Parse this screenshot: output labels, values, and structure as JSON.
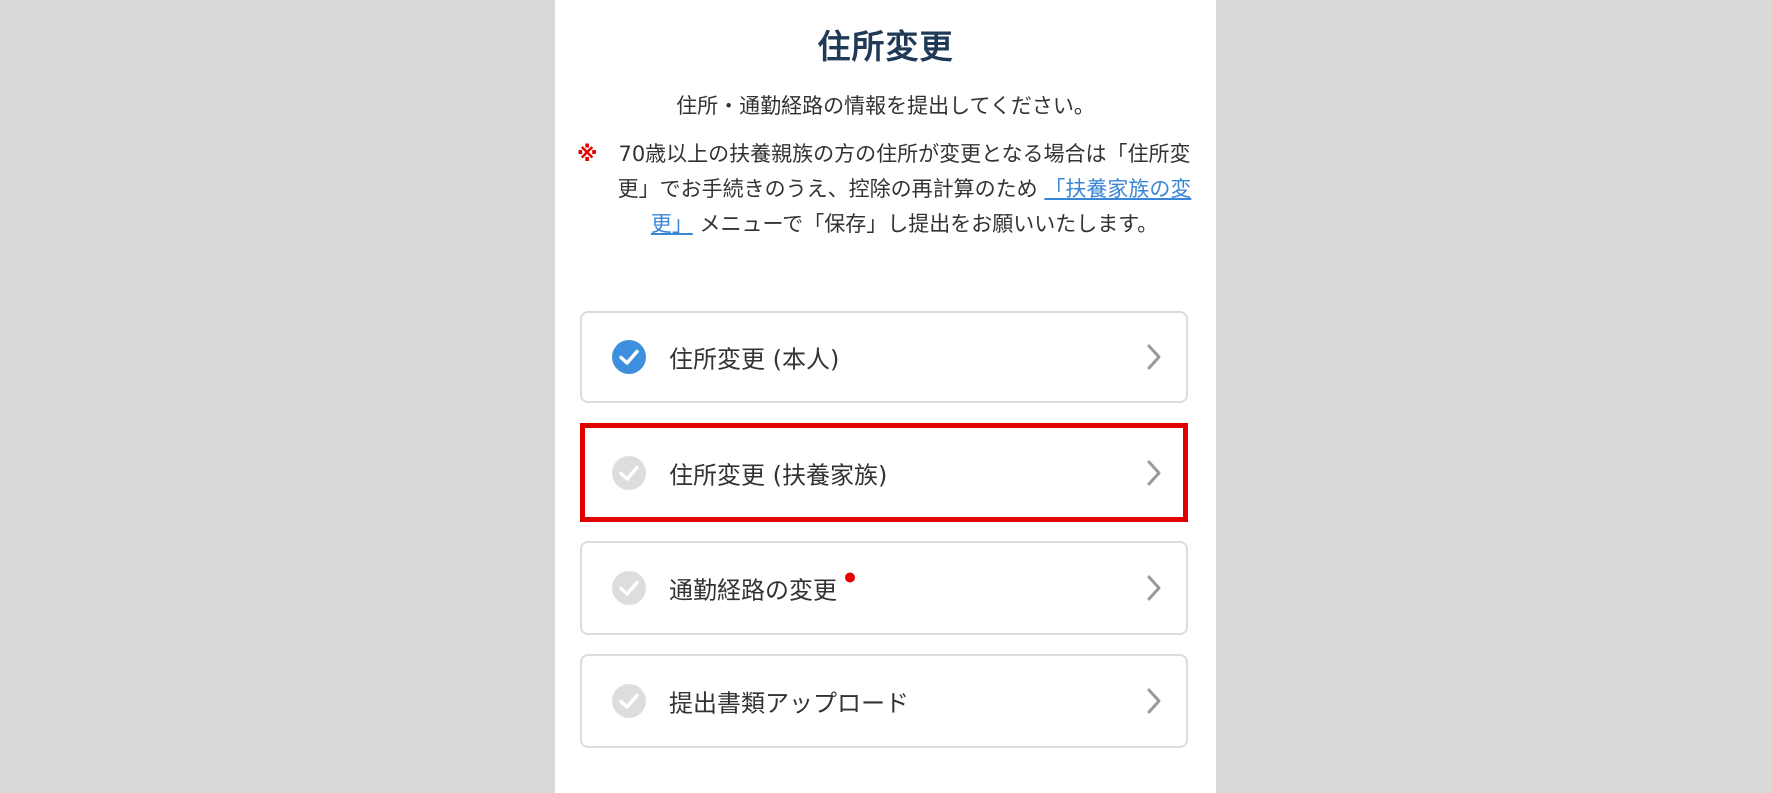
{
  "page": {
    "title": "住所変更",
    "subtitle": "住所・通勤経路の情報を提出してください。",
    "notice": {
      "mark": "※",
      "text_before_link": "70歳以上の扶養親族の方の住所が変更となる場合は「住所変更」でお手続きのうえ、控除の再計算のため",
      "link_text": "「扶養家族の変更」",
      "text_after_link": "メニューで「保存」し提出をお願いいたします。"
    }
  },
  "menu": {
    "items": [
      {
        "label": "住所変更 (本人)",
        "status": "completed",
        "check_icon": "check-circle-filled-icon",
        "chevron_icon": "chevron-right-icon"
      },
      {
        "label": "住所変更 (扶養家族)",
        "status": "incomplete",
        "highlighted": true,
        "check_icon": "check-circle-icon",
        "chevron_icon": "chevron-right-icon"
      },
      {
        "label": "通勤経路の変更",
        "status": "incomplete",
        "required": true,
        "check_icon": "check-circle-icon",
        "chevron_icon": "chevron-right-icon"
      },
      {
        "label": "提出書類アップロード",
        "status": "incomplete",
        "check_icon": "check-circle-icon",
        "chevron_icon": "chevron-right-icon"
      }
    ]
  },
  "colors": {
    "title": "#1f3a56",
    "link": "#3a86d6",
    "completed_check": "#3e8fdd",
    "incomplete_check": "#dddddd",
    "required_dot": "#e60000",
    "highlight_border": "#e00000",
    "background": "#d9d9d9",
    "panel": "#ffffff"
  }
}
